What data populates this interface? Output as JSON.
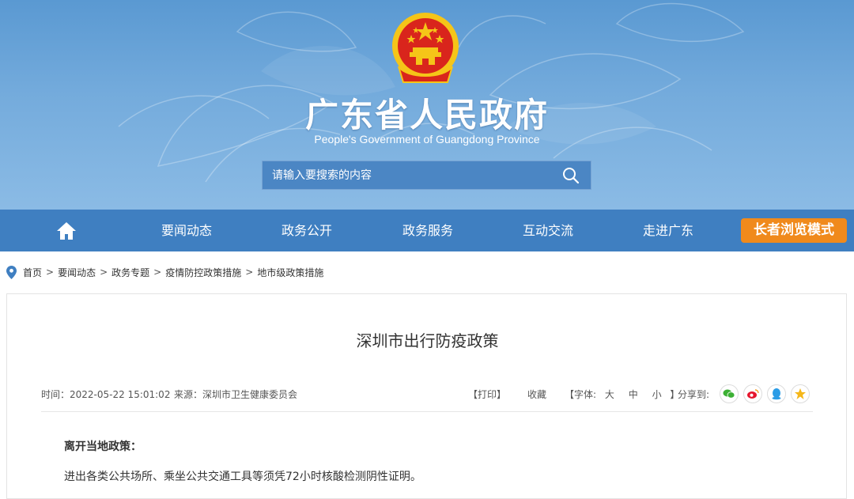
{
  "header": {
    "title": "广东省人民政府",
    "subtitle": "People's Government of Guangdong Province",
    "search_placeholder": "请输入要搜索的内容",
    "icons": [
      "national-emblem-icon",
      "search-icon"
    ],
    "colors": {
      "banner": "#5a99d2",
      "emblem_red": "#d9251c",
      "emblem_gold": "#f5c518"
    }
  },
  "nav": {
    "items": [
      {
        "label": "要闻动态"
      },
      {
        "label": "政务公开"
      },
      {
        "label": "政务服务"
      },
      {
        "label": "互动交流"
      },
      {
        "label": "走进广东"
      }
    ],
    "elder_mode": "长者浏览模式",
    "colors": {
      "bar": "#3f7fc1",
      "elder_button": "#f08a1c"
    }
  },
  "breadcrumb": {
    "items": [
      "首页",
      "要闻动态",
      "政务专题",
      "疫情防控政策措施",
      "地市级政策措施"
    ],
    "separator": ">"
  },
  "article": {
    "title": "深圳市出行防疫政策",
    "time_label": "时间：2022-05-22 15:01:02",
    "source_label": "来源：深圳市卫生健康委员会",
    "print": "【打印】",
    "favorite": "收藏",
    "font_label": "【字体:",
    "font_sizes": [
      "大",
      "中",
      "小"
    ],
    "font_close": "】",
    "share_label": "分享到:",
    "share_icons": [
      "wechat-icon",
      "weibo-icon",
      "qq-icon",
      "qzone-icon"
    ],
    "section_heading": "离开当地政策：",
    "paragraph": "进出各类公共场所、乘坐公共交通工具等须凭72小时核酸检测阴性证明。"
  }
}
